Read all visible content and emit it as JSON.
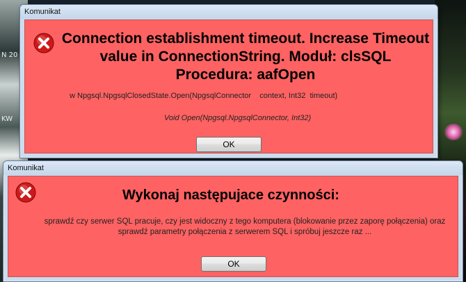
{
  "desktop": {
    "label_1": "N 20",
    "label_2": "KW"
  },
  "dialog_1": {
    "window_title": "Komunikat",
    "icon": "error-icon",
    "message": "Connection establishment timeout. Increase Timeout value in ConnectionString. Moduł: clsSQL Procedura: aafOpen",
    "stack_line_1": "w Npgsql.NpgsqlClosedState.Open(NpgsqlConnector    context, Int32  timeout)",
    "stack_line_2": "Void Open(Npgsql.NpgsqlConnector, Int32)",
    "ok_label": "OK"
  },
  "dialog_2": {
    "window_title": "Komunikat",
    "icon": "error-icon",
    "message": "Wykonaj następujace czynności:",
    "body": "sprawdź czy serwer SQL pracuje, czy jest widoczny z tego komputera  (blokowanie  przez zaporę połączenia)  oraz sprawdź parametry połączenia  z serwerem SQL i spróbuj jeszcze raz ...",
    "ok_label": "OK"
  },
  "colors": {
    "dialog_background": "#ff6262",
    "titlebar": "#c4d6ea",
    "error_icon": "#d01818"
  }
}
